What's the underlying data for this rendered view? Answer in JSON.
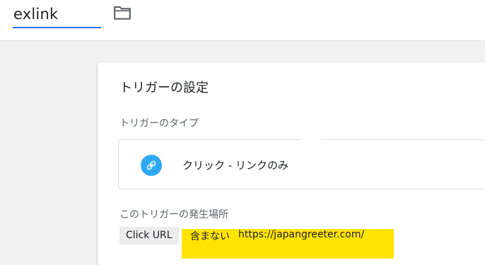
{
  "header": {
    "tag_name": "exlink",
    "folder_icon": "folder-icon"
  },
  "card": {
    "title": "トリガーの設定",
    "type_section_label": "トリガーのタイプ",
    "trigger_type": {
      "icon": "link-icon",
      "icon_color": "#2fa8f4",
      "label": "クリック - リンクのみ"
    },
    "fires_on_label": "このトリガーの発生場所",
    "filter": {
      "variable": "Click URL",
      "operator": "含まない",
      "value": "https://japangreeter.com/",
      "highlight_color": "#ffe400"
    }
  },
  "colors": {
    "accent": "#1a73e8",
    "canvas_background": "#f1f1f1"
  }
}
